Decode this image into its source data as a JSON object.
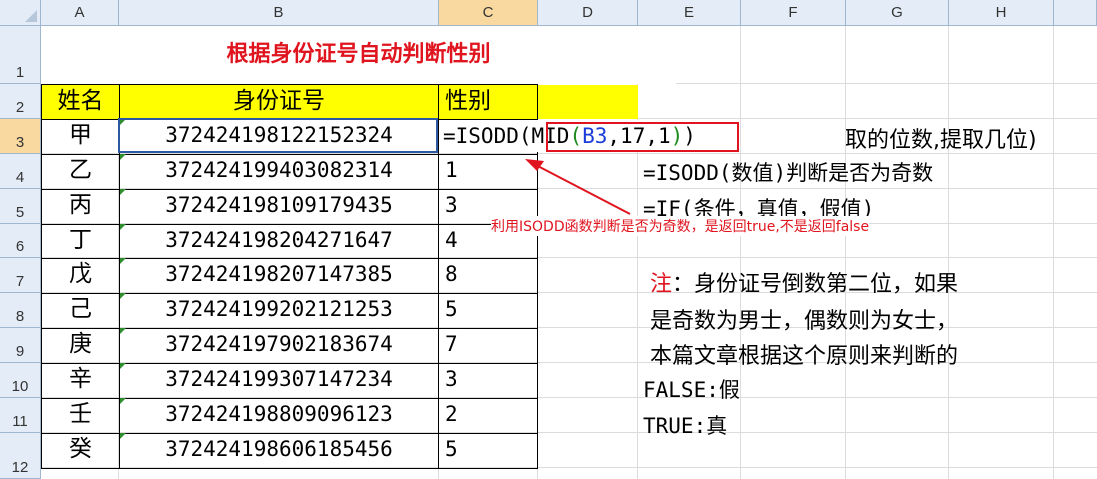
{
  "columns": [
    "A",
    "B",
    "C",
    "D",
    "E",
    "F",
    "G",
    "H"
  ],
  "rows": [
    "1",
    "2",
    "3",
    "4",
    "5",
    "6",
    "7",
    "8",
    "9",
    "10",
    "11",
    "12"
  ],
  "title": "根据身份证号自动判断性别",
  "headers": {
    "name": "姓名",
    "id": "身份证号",
    "sex": "性别"
  },
  "table": [
    {
      "name": "甲",
      "id": "372424198122152324",
      "sex": ""
    },
    {
      "name": "乙",
      "id": "372424199403082314",
      "sex": "1"
    },
    {
      "name": "丙",
      "id": "372424198109179435",
      "sex": "3"
    },
    {
      "name": "丁",
      "id": "372424198204271647",
      "sex": "4"
    },
    {
      "name": "戊",
      "id": "372424198207147385",
      "sex": "8"
    },
    {
      "name": "己",
      "id": "372424199202121253",
      "sex": "5"
    },
    {
      "name": "庚",
      "id": "372424197902183674",
      "sex": "7"
    },
    {
      "name": "辛",
      "id": "372424199307147234",
      "sex": "3"
    },
    {
      "name": "壬",
      "id": "372424198809096123",
      "sex": "2"
    },
    {
      "name": "癸",
      "id": "372424198606185456",
      "sex": "5"
    }
  ],
  "formula": {
    "prefix": "=ISODD(",
    "fn": "MID",
    "open": "(",
    "ref": "B3",
    "args": ",17,1",
    "close": "))"
  },
  "helper_text": {
    "position_hint": "取的位数,提取几位)",
    "isodd_syntax": "=ISODD(数值)判断是否为奇数",
    "if_syntax": "=IF(条件，真值，假值)"
  },
  "annotation": "利用ISODD函数判断是否为奇数，是返回true,不是返回false",
  "note": {
    "label": "注",
    "line1": "：身份证号倒数第二位，如果",
    "line2": "是奇数为男士，偶数则为女士，",
    "line3": "本篇文章根据这个原则来判断的",
    "false_text": "FALSE:假",
    "true_text": "TRUE:真"
  },
  "colors": {
    "title": "#e0141e",
    "header_fill": "#ffff00",
    "annotation": "#e0141e",
    "ref": "#1a3cd8",
    "paren": "#1b8a1b"
  }
}
